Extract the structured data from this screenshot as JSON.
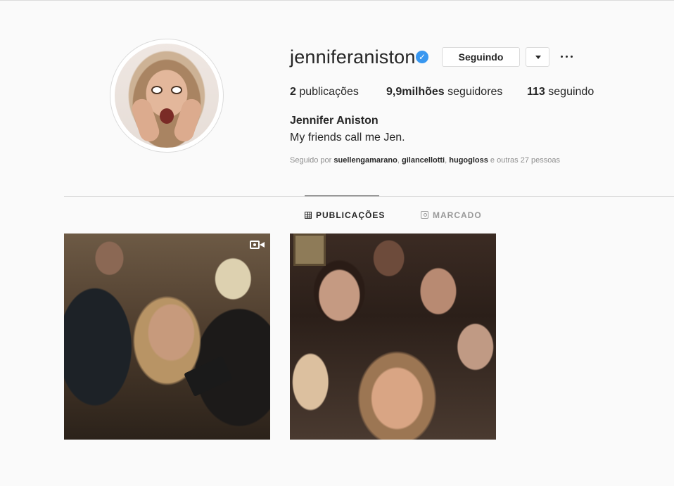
{
  "profile": {
    "username": "jenniferaniston",
    "verified_icon": "verified-badge-icon",
    "follow_button_label": "Seguindo",
    "full_name": "Jennifer Aniston",
    "bio": "My friends call me Jen.",
    "stats": {
      "posts_count": "2",
      "posts_label": "publicações",
      "followers_count": "9,9milhões",
      "followers_label": "seguidores",
      "following_count": "113",
      "following_label": "seguindo"
    },
    "followed_by": {
      "prefix": "Seguido por",
      "users": [
        "suellengamarano",
        "gilancellotti",
        "hugogloss"
      ],
      "suffix": "e outras 27 pessoas"
    }
  },
  "tabs": [
    {
      "label": "PUBLICAÇÕES",
      "icon": "grid-icon",
      "active": true
    },
    {
      "label": "MARCADO",
      "icon": "tagged-icon",
      "active": false
    }
  ],
  "posts": [
    {
      "type": "video",
      "icon": "video-icon"
    },
    {
      "type": "photo"
    }
  ],
  "colors": {
    "background": "#fafafa",
    "verified": "#3897f0",
    "muted": "#8e8e8e",
    "border": "#dbdbdb"
  }
}
